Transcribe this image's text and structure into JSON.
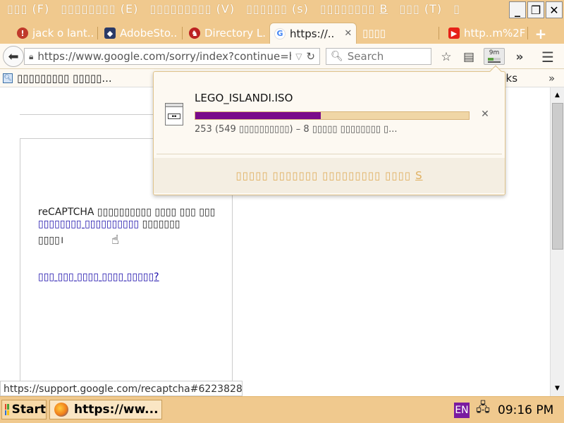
{
  "menubar": {
    "items": [
      {
        "label": "▯▯▯",
        "accel": "(F)"
      },
      {
        "label": "▯▯▯▯▯▯▯▯",
        "accel": "(E)"
      },
      {
        "label": "▯▯▯▯▯▯▯▯▯",
        "accel": "(V)"
      },
      {
        "label": "▯▯▯▯▯▯",
        "accel": "(s)"
      },
      {
        "label": "▯▯▯▯▯▯▯▯",
        "accel": "B"
      },
      {
        "label": "▯▯▯",
        "accel": "(T)"
      },
      {
        "label": "▯",
        "accel": ""
      }
    ],
    "window_controls": {
      "minimize": "_",
      "restore": "❐",
      "close": "✕"
    }
  },
  "tabs": [
    {
      "label": "jack o lant..",
      "icon": "tab-favicon-shield",
      "active": false
    },
    {
      "label": "AdobeSto..",
      "icon": "tab-favicon-badge",
      "active": false
    },
    {
      "label": "Directory L..",
      "icon": "tab-favicon-flame",
      "active": false
    },
    {
      "label": "https://..",
      "icon": "google-icon",
      "active": true,
      "close": "✕"
    },
    {
      "label": "▯▯▯▯",
      "icon": "",
      "active": false
    },
    {
      "label": "http..m%2F",
      "icon": "youtube-icon",
      "active": false
    }
  ],
  "newtab": "+",
  "navbar": {
    "url": "https://www.google.com/sorry/index?continue=http",
    "search_placeholder": "Search",
    "download_eta": "9m",
    "download_progress": 0.46
  },
  "bookmarks": {
    "item_label": "▯▯▯▯▯▯▯▯▯ ▯▯▯▯▯...",
    "right_label": "nks",
    "overflow": "»"
  },
  "page": {
    "para_intro": "reCAPTCHA ▯▯▯▯▯▯▯▯▯▯ ▯▯▯▯ ▯▯▯ ▯▯▯ ",
    "para_link": "▯▯▯▯▯▯▯▯ ▯▯▯▯▯▯▯▯▯▯",
    "para_after": " ▯▯▯▯▯▯▯",
    "para_tail": "▯▯▯▯।",
    "help_link": "▯▯▯ ▯▯▯ ▯▯▯▯ ▯▯▯▯ ▯▯▯▯▯?"
  },
  "status_url": "https://support.google.com/recaptcha#6223828",
  "download": {
    "filename": "LEGO_ISLANDI.ISO",
    "progress": 0.46,
    "status": "253 (549 ▯▯▯▯▯▯▯▯▯▯) – 8 ▯▯▯▯▯ ▯▯▯▯▯▯▯▯ ▯...",
    "close": "✕",
    "footer_label": "▯▯▯▯▯ ▯▯▯▯▯▯▯ ▯▯▯▯▯▯▯▯▯ ▯▯▯▯",
    "footer_accel": "S"
  },
  "taskbar": {
    "start_label": "Start",
    "task_label": "https://ww...",
    "language": "EN",
    "clock": "09:16 PM"
  },
  "colors": {
    "chrome_tan": "#f0c98e",
    "progress_fill": "#7a0a8a",
    "link": "#1a0dab"
  }
}
